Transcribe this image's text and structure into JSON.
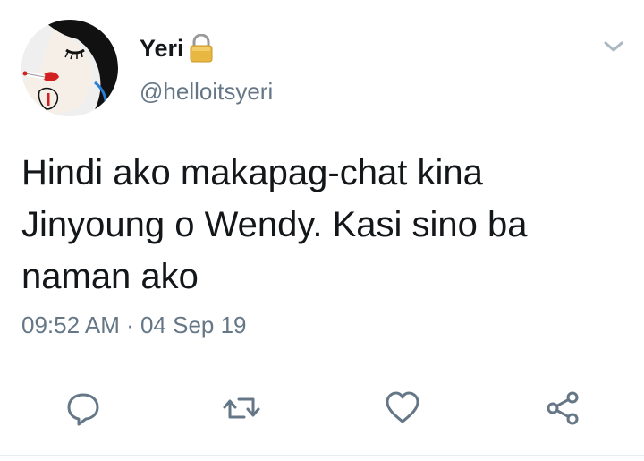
{
  "tweet": {
    "author": {
      "display_name": "Yeri",
      "handle": "@helloitsyeri",
      "protected": true
    },
    "text": "Hindi ako makapag-chat kina\nJinyoung o Wendy. Kasi sino ba\nnaman ako",
    "timestamp": "09:52 AM · 04 Sep 19"
  },
  "icons": {
    "lock": "lock-icon",
    "menu": "chevron-down-icon",
    "reply": "reply-icon",
    "retweet": "retweet-icon",
    "like": "heart-icon",
    "share": "share-icon"
  },
  "colors": {
    "text": "#14171a",
    "secondary": "#657786",
    "icon": "#657786",
    "lock": "#e8b741",
    "divider": "#d6dbdf"
  }
}
